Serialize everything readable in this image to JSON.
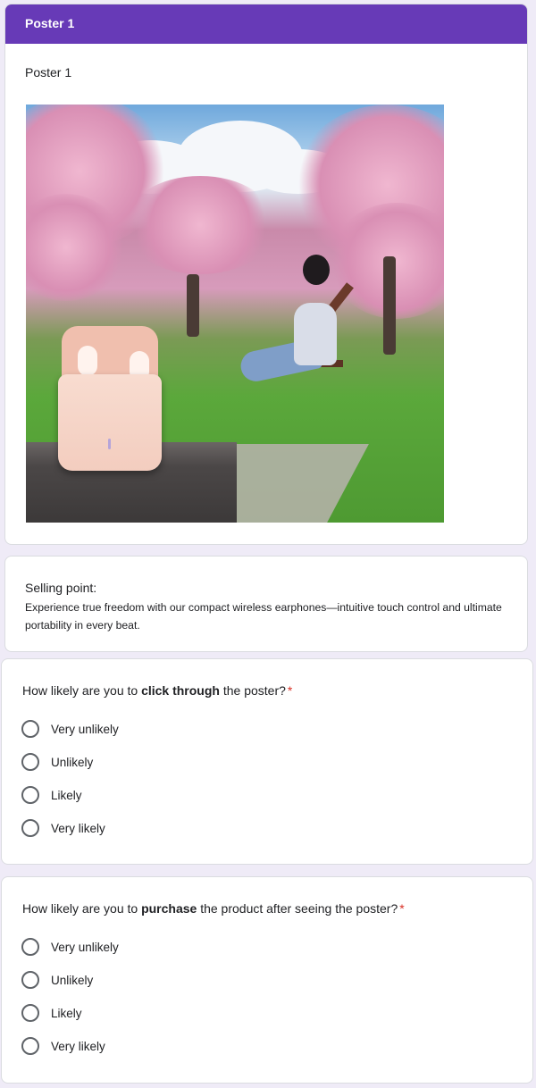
{
  "section": {
    "header_title": "Poster 1",
    "subtitle": "Poster 1",
    "poster_image_alt": "Poster image: pink wireless earbuds case on stone ledge with cherry blossom park and woman on bench"
  },
  "selling": {
    "title": "Selling point:",
    "text": "Experience true freedom with our compact wireless earphones—intuitive touch control and ultimate portability in every beat."
  },
  "questions": [
    {
      "prefix": "How likely are you to ",
      "bold": "click through",
      "suffix": " the poster?",
      "required_mark": "*",
      "options": [
        "Very unlikely",
        "Unlikely",
        "Likely",
        "Very likely"
      ]
    },
    {
      "prefix": "How likely are you to ",
      "bold": "purchase",
      "suffix": " the product after seeing the poster?",
      "required_mark": "*",
      "options": [
        "Very unlikely",
        "Unlikely",
        "Likely",
        "Very likely"
      ]
    }
  ],
  "colors": {
    "accent": "#673ab7",
    "background": "#efebf7",
    "required": "#d93025"
  }
}
